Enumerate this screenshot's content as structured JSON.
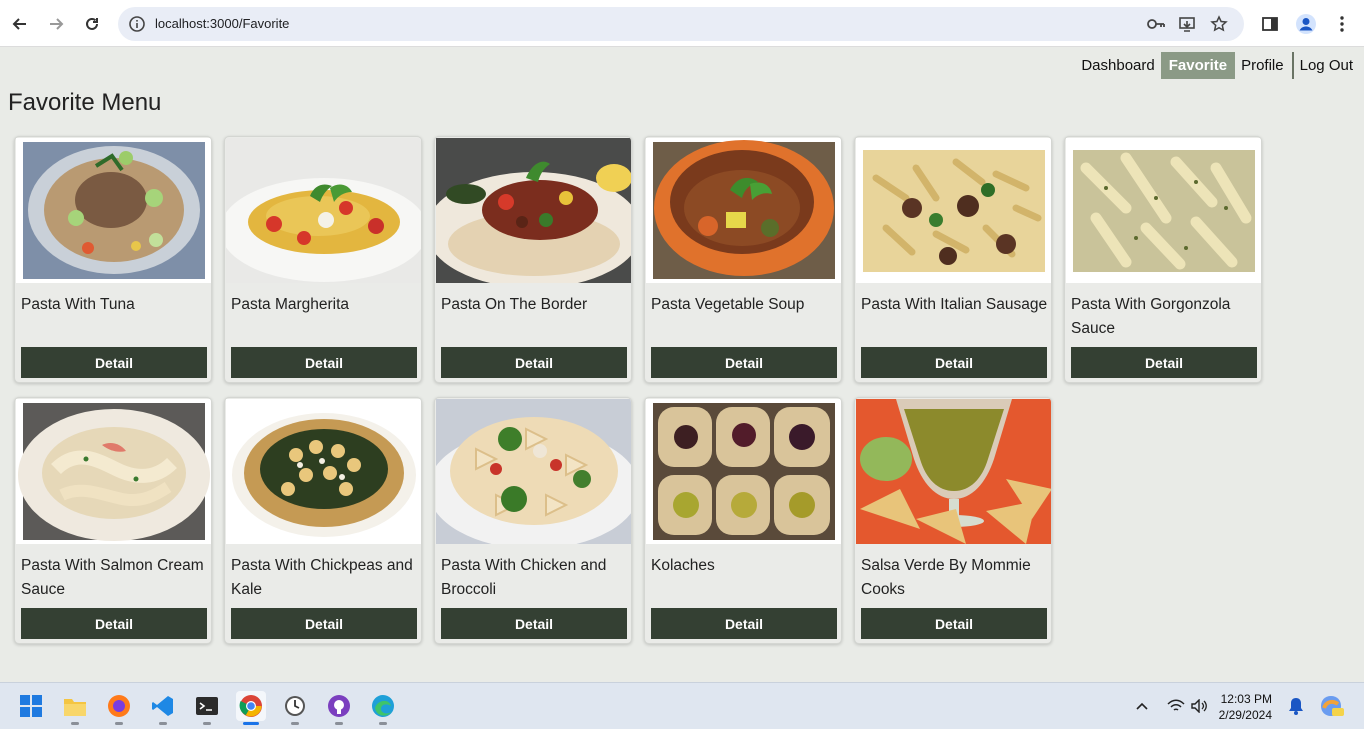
{
  "browser": {
    "url": "localhost:3000/Favorite"
  },
  "nav": {
    "items": [
      {
        "label": "Dashboard",
        "active": false
      },
      {
        "label": "Favorite",
        "active": true
      },
      {
        "label": "Profile",
        "active": false
      },
      {
        "label": "Log Out",
        "active": false
      }
    ]
  },
  "page": {
    "title": "Favorite Menu"
  },
  "cards": [
    {
      "title": "Pasta With Tuna",
      "button": "Detail"
    },
    {
      "title": "Pasta Margherita",
      "button": "Detail"
    },
    {
      "title": "Pasta On The Border",
      "button": "Detail"
    },
    {
      "title": "Pasta Vegetable Soup",
      "button": "Detail"
    },
    {
      "title": "Pasta With Italian Sausage",
      "button": "Detail"
    },
    {
      "title": "Pasta With Gorgonzola Sauce",
      "button": "Detail"
    },
    {
      "title": "Pasta With Salmon Cream Sauce",
      "button": "Detail"
    },
    {
      "title": "Pasta With Chickpeas and Kale",
      "button": "Detail"
    },
    {
      "title": "Pasta With Chicken and Broccoli",
      "button": "Detail"
    },
    {
      "title": "Kolaches",
      "button": "Detail"
    },
    {
      "title": "Salsa Verde By Mommie Cooks",
      "button": "Detail"
    }
  ],
  "taskbar": {
    "time": "12:03 PM",
    "date": "2/29/2024"
  }
}
